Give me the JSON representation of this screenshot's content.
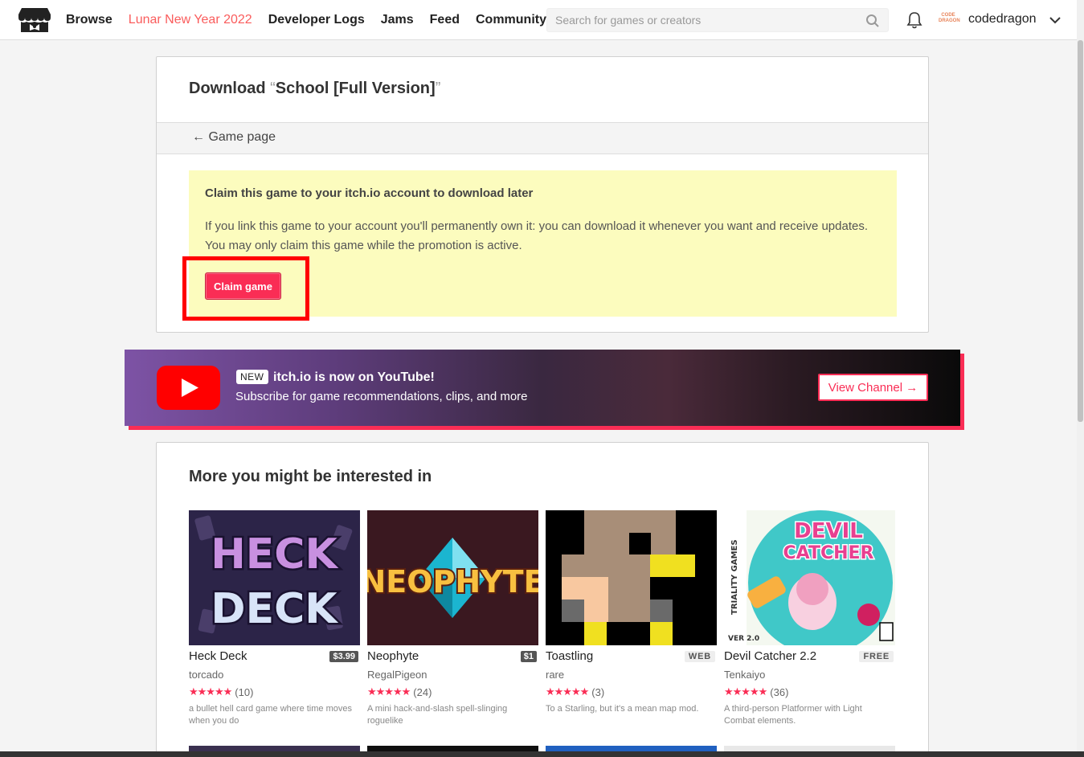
{
  "header": {
    "nav": [
      "Browse",
      "Lunar New Year 2022",
      "Developer Logs",
      "Jams",
      "Feed",
      "Community"
    ],
    "search_placeholder": "Search for games or creators",
    "username": "codedragon",
    "avatar_text": "CODE DRAGON"
  },
  "download": {
    "title_prefix": "Download ",
    "open_quote": "“",
    "game_name": "School [Full Version]",
    "close_quote": "”",
    "back_link": "← Game page",
    "claim_heading": "Claim this game to your itch.io account to download later",
    "claim_text": "If you link this game to your account you'll permanently own it: you can download it whenever you want and receive updates. You may only claim this game while the promotion is active.",
    "claim_button": "Claim game"
  },
  "banner": {
    "badge": "NEW",
    "title": "itch.io is now on YouTube!",
    "subtitle": "Subscribe for game recommendations, clips, and more",
    "button": "View Channel →"
  },
  "more": {
    "title": "More you might be interested in",
    "games": [
      {
        "title": "Heck Deck",
        "price": "$3.99",
        "tag": "",
        "author": "torcado",
        "stars": "★★★★★",
        "count": "(10)",
        "desc": "a bullet hell card game where time moves when you do"
      },
      {
        "title": "Neophyte",
        "price": "$1",
        "tag": "",
        "author": "RegalPigeon",
        "stars": "★★★★★",
        "count": "(24)",
        "desc": "A mini hack-and-slash spell-slinging roguelike"
      },
      {
        "title": "Toastling",
        "price": "",
        "tag": "WEB",
        "author": "rare",
        "stars": "★★★★★",
        "count": "(3)",
        "desc": "To a Starling, but it's a mean map mod."
      },
      {
        "title": "Devil Catcher 2.2",
        "price": "",
        "tag": "FREE",
        "author": "Tenkaiyo",
        "stars": "★★★★★",
        "count": "(36)",
        "desc": "A third-person Platformer with Light Combat elements."
      }
    ],
    "thumb_text": {
      "heck_deck": [
        "HECK",
        "DECK"
      ],
      "neophyte": "NEOPHYTE",
      "devil_catcher": [
        "DEVIL",
        "CATCHER"
      ],
      "triality": "TRIALITY GAMES",
      "version": "VER 2.0"
    }
  },
  "colors": {
    "accent": "#fa2d55",
    "highlight_nav": "#fa5c5c",
    "claim_bg": "#fcfcbe",
    "annotation_red": "#ff0000"
  }
}
